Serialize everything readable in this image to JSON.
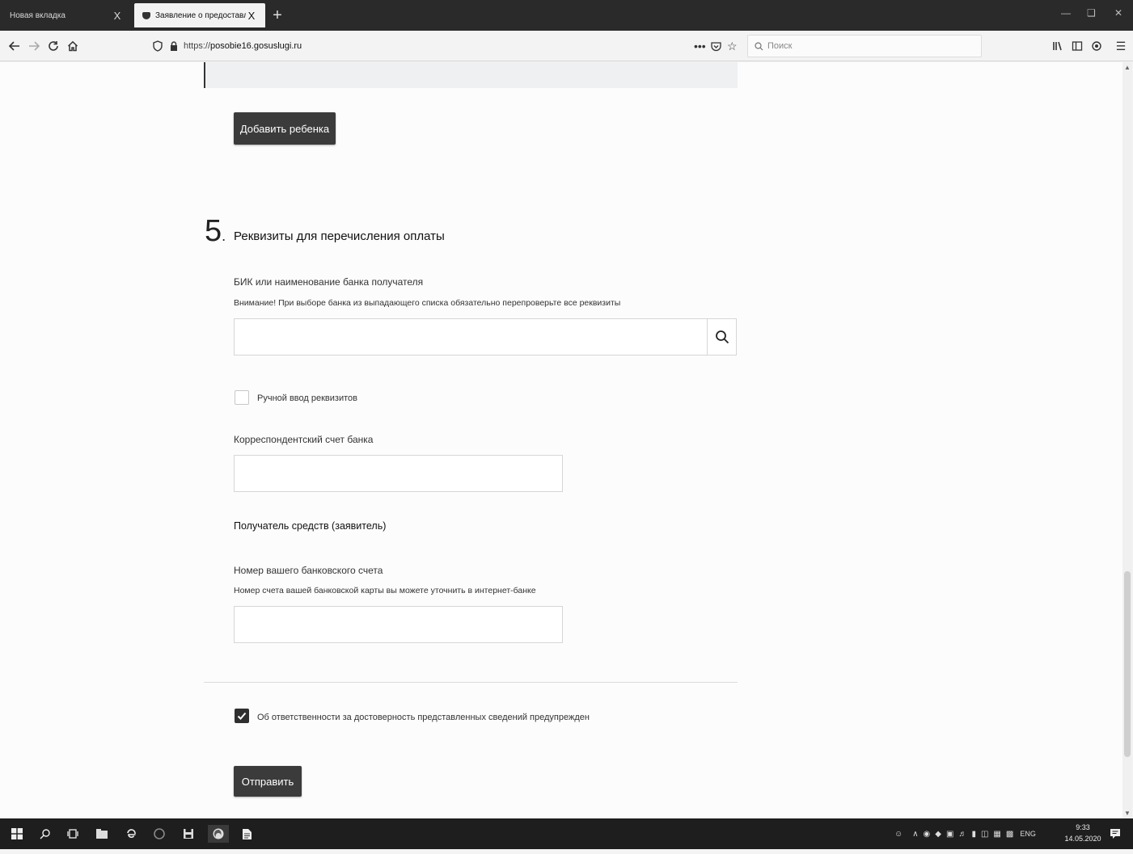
{
  "browser": {
    "tabs": [
      {
        "title": "Новая вкладка",
        "close": "X"
      },
      {
        "title": "Заявление о предоставлении",
        "close": "X"
      }
    ],
    "new_tab": "+",
    "url": {
      "prefix": "https://",
      "host": "posobie16.gosuslugi.ru"
    },
    "page_actions": "•••",
    "search_placeholder": "Поиск"
  },
  "form": {
    "add_child_button": "Добавить ребенка",
    "section": {
      "number": "5",
      "number_suffix": ".",
      "title": "Реквизиты для перечисления оплаты"
    },
    "bank": {
      "label": "БИК или наименование банка получателя",
      "hint": "Внимание! При выборе банка из выпадающего списка обязательно перепроверьте все реквизиты",
      "value": ""
    },
    "manual_entry": {
      "label": "Ручной ввод реквизитов",
      "checked": false
    },
    "corr_account": {
      "label": "Корреспондентский счет банка",
      "value": ""
    },
    "recipient_heading": "Получатель средств (заявитель)",
    "account": {
      "label": "Номер вашего банковского счета",
      "hint": "Номер счета вашей банковской карты вы можете уточнить в интернет-банке",
      "value": ""
    },
    "responsibility": {
      "label": "Об ответственности за достоверность представленных сведений предупрежден",
      "checked": true
    },
    "submit_button": "Отправить"
  },
  "taskbar": {
    "language": "ENG",
    "time": "9:33",
    "date": "14.05.2020"
  },
  "icons": {
    "back": "arrow-left-icon",
    "forward": "arrow-right-icon",
    "reload": "reload-icon",
    "home": "home-icon",
    "search": "magnifier-icon",
    "check": "checkmark-icon"
  },
  "colors": {
    "button": "#3b3b3b",
    "tabbar": "#2a2a2a",
    "taskbar": "#1e1e1e"
  }
}
